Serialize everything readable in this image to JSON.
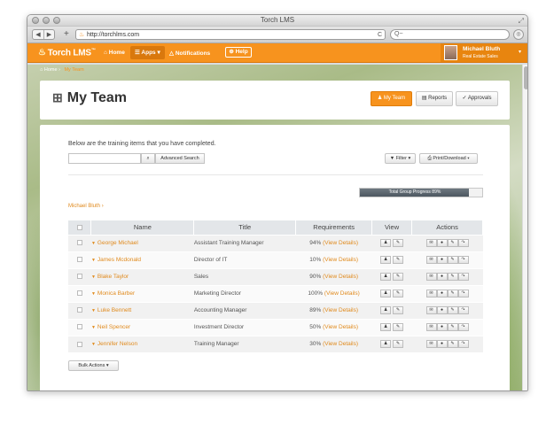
{
  "browser": {
    "window_title": "Torch LMS",
    "url": "http://torchlms.com",
    "search_placeholder": "Q~",
    "back_glyph": "◀",
    "forward_glyph": "▶",
    "new_tab_glyph": "+",
    "reload_glyph": "C",
    "favicon_glyph": "♨",
    "reader_glyph": "◎",
    "resize_glyph": "⤢"
  },
  "nav": {
    "logo": "Torch LMS",
    "logo_mark": "™",
    "logo_icon": "flame-icon",
    "home": "Home",
    "home_icon": "home-icon",
    "apps": "Apps",
    "apps_icon": "list-icon",
    "notifications": "Notifications",
    "notifications_icon": "bell-icon",
    "help": "Help",
    "help_icon": "lifebuoy-icon",
    "user_name": "Michael Bluth",
    "user_role": "Real Estate Sales",
    "brand_color": "#f7931e"
  },
  "breadcrumb": {
    "home": "Home",
    "current": "My Team",
    "home_icon": "home-icon"
  },
  "page": {
    "title": "My Team",
    "title_icon": "sitemap-icon",
    "tabs": [
      {
        "label": "My Team",
        "icon": "team-icon",
        "active": true
      },
      {
        "label": "Reports",
        "icon": "report-icon",
        "active": false
      },
      {
        "label": "Approvals",
        "icon": "check-icon",
        "active": false
      }
    ]
  },
  "panel": {
    "intro": "Below are the training items that you have completed.",
    "search_value": "",
    "search_icon": "search-icon",
    "advanced_search": "Advanced Search",
    "filter": "Filter",
    "filter_icon": "filter-icon",
    "print_download": "Print/Download",
    "print_icon": "print-icon",
    "progress_label": "Total Group Progress 89%",
    "progress_value": 0.89,
    "crumb": "Michael Bluth",
    "bulk_actions": "Bulk Actions"
  },
  "table": {
    "headers": [
      "",
      "Name",
      "Title",
      "Requirements",
      "View",
      "Actions"
    ],
    "view_icons": [
      "user-icon",
      "edit-icon"
    ],
    "action_icons": [
      "mail-icon",
      "comment-icon",
      "edit-icon",
      "share-icon"
    ],
    "rows": [
      {
        "name": "George Michael",
        "title": "Assistant Training Manager",
        "pct": "94%",
        "details": "(View Details)"
      },
      {
        "name": "James Mcdonald",
        "title": "Director of IT",
        "pct": "10%",
        "details": "(View Details)"
      },
      {
        "name": "Blake Taylor",
        "title": "Sales",
        "pct": "90%",
        "details": "(View Details)"
      },
      {
        "name": "Monica Barber",
        "title": "Marketing Director",
        "pct": "100%",
        "details": "(View Details)"
      },
      {
        "name": "Luke Bennett",
        "title": "Accounting Manager",
        "pct": "89%",
        "details": "(View Details)"
      },
      {
        "name": "Neil Spencer",
        "title": "Investment Director",
        "pct": "50%",
        "details": "(View Details)"
      },
      {
        "name": "Jennifer Nelson",
        "title": "Training Manager",
        "pct": "30%",
        "details": "(View Details)"
      }
    ]
  }
}
